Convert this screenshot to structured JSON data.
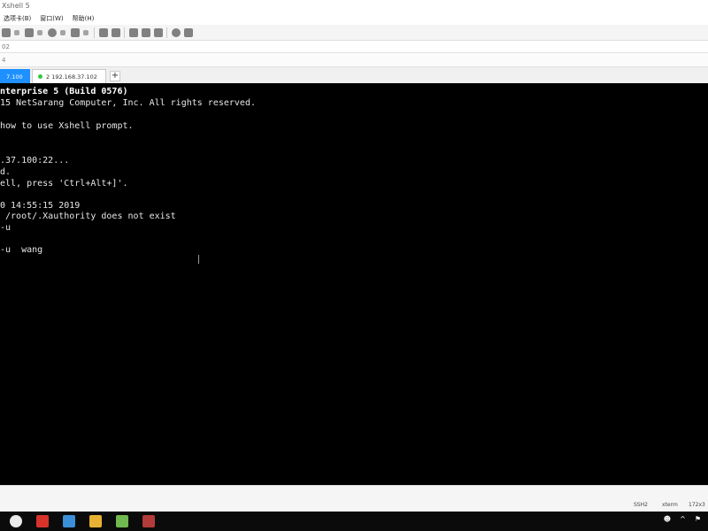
{
  "window": {
    "title": "Xshell 5",
    "menu": [
      "选项卡(B)",
      "窗口(W)",
      "帮助(H)"
    ],
    "address": "02",
    "blank_row_text": "4"
  },
  "toolbar": {
    "icons": [
      "print-icon",
      "network-icon",
      "globe-icon",
      "font-icon",
      "settings-icon",
      "transfer-icon",
      "fullscreen-icon",
      "lock-icon",
      "keyboard-icon",
      "help-icon",
      "chat-icon"
    ]
  },
  "tabs": {
    "active_label": "7.100",
    "second_label": "2 192.168.37.102",
    "add_label": "+"
  },
  "terminal": {
    "lines": [
      "nterprise 5 (Build 0576)",
      "15 NetSarang Computer, Inc. All rights reserved.",
      "",
      "how to use Xshell prompt.",
      "",
      "",
      ".37.100:22...",
      "d.",
      "ell, press 'Ctrl+Alt+]'.",
      "",
      "0 14:55:15 2019",
      " /root/.Xauthority does not exist",
      "-u",
      "",
      "-u  wang"
    ]
  },
  "status": {
    "ssh": "SSH2",
    "terminal_type": "xterm",
    "size": "172x3"
  },
  "taskbar": {
    "apps": [
      "chrome-icon",
      "pdf-icon",
      "mail-icon",
      "files-icon",
      "notes-icon",
      "xshell-icon"
    ]
  },
  "colors": {
    "tab_active": "#1e90ff",
    "terminal_bg": "#000000",
    "terminal_fg": "#e6e6e6"
  }
}
